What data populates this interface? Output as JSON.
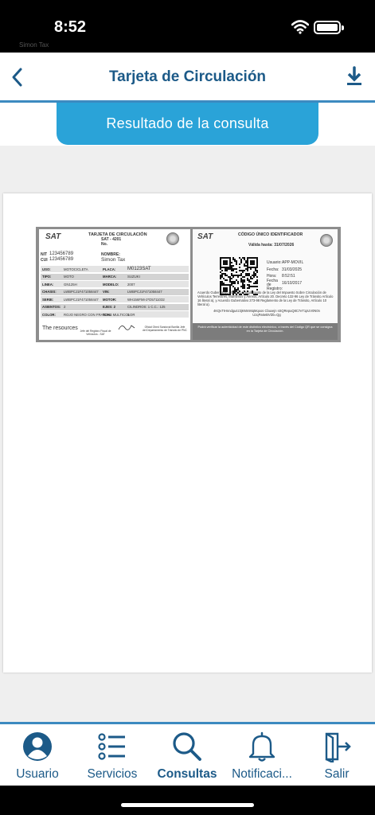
{
  "status_bar": {
    "time": "8:52",
    "carrier": "Simon Tax"
  },
  "header": {
    "title": "Tarjeta de Circulación"
  },
  "result_button": {
    "label": "Resultado de la consulta"
  },
  "card": {
    "left": {
      "logo": "SAT",
      "title": "TARJETA DE CIRCULACIÓN",
      "subtitle": "SAT - 4201",
      "no_label": "No.",
      "nit_label": "NIT",
      "nit": "123456789",
      "cui_label": "CUI",
      "cui": "123456789",
      "nombre_label": "NOMBRE:",
      "nombre": "Simon Tax",
      "rows": [
        {
          "l1": "USO:",
          "v1": "MOTOCICLETA",
          "l2": "PLACA:",
          "v2": "M0123SAT"
        },
        {
          "l1": "TIPO:",
          "v1": "MOTO",
          "l2": "MARCA:",
          "v2": "SUZUKI"
        },
        {
          "l1": "LINEA:",
          "v1": "GN125H",
          "l2": "MODELO:",
          "v2": "2007"
        },
        {
          "l1": "CHASIS:",
          "v1": "LWBPCJ1F471058447",
          "l2": "VIN:",
          "v2": "LWBPCJ1F471058447"
        },
        {
          "l1": "SERIE:",
          "v1": "LWBPCJ1F471058447",
          "l2": "MOTOR:",
          "v2": "WH156FMI-2*D5711032"
        },
        {
          "l1": "ASIENTOS:",
          "v1": "2",
          "l2": "EJES: 2",
          "v2": "CILINDROS: 1  C.C.: 125"
        },
        {
          "l1": "COLOR:",
          "v1": "ROJO NEGRO CON FRANJAS MULTICOLOR",
          "l2": "TON.:",
          "v2": "0"
        }
      ],
      "footer_text": "The resources",
      "sig1": "Jefe del Registro Fiscal de Vehículos - SAT",
      "sig2": "Oficial Obed Sandoval Bonilla Jefe del Departamento de Tránsito de PNC"
    },
    "right": {
      "logo": "SAT",
      "title": "CÓDIGO ÚNICO IDENTIFICADOR",
      "valid": "Válida hasta: 31/07/2026",
      "usuario_label": "Usuario:",
      "usuario": "APP-MOVIL",
      "fecha_label": "Fecha:",
      "fecha": "31/03/2025",
      "hora_label": "Hora:",
      "hora": "8:52:51",
      "registro_label": "Fecha de Registro:",
      "registro": "16/10/2017",
      "legal": "Acuerdo Gubernativo 104-2014 Reglamento de la Ley del Impuesto Sobre Circulación de Vehículos Terrestres, Marítimos y Aéreos, Artículo 20. Decreto 132-96 Ley de Tránsito Artículo 16 literal a), y Acuerdo Gubernativo 273-98 Reglamento de la Ley de Tránsito, Artículo 10 literal a).",
      "code": "4KQvTIHnndgu4z3jKMmMqMqoos Cbuxejn sSQRepuQ8C7eT1pUV0N0n UzqPa6eBVDb=Qg",
      "footer": "Podrá verificar la autenticidad de este distintivo electrónico, a través del Código QR que se consigna en la Tarjeta de Circulación."
    }
  },
  "tabs": [
    {
      "label": "Usuario",
      "icon": "user-circle-icon"
    },
    {
      "label": "Servicios",
      "icon": "list-icon"
    },
    {
      "label": "Consultas",
      "icon": "search-icon",
      "active": true
    },
    {
      "label": "Notificaci...",
      "icon": "bell-icon"
    },
    {
      "label": "Salir",
      "icon": "exit-door-icon"
    }
  ],
  "colors": {
    "primary": "#1c5a88",
    "accent": "#2aa3d8",
    "divider": "#3c8ac0"
  }
}
